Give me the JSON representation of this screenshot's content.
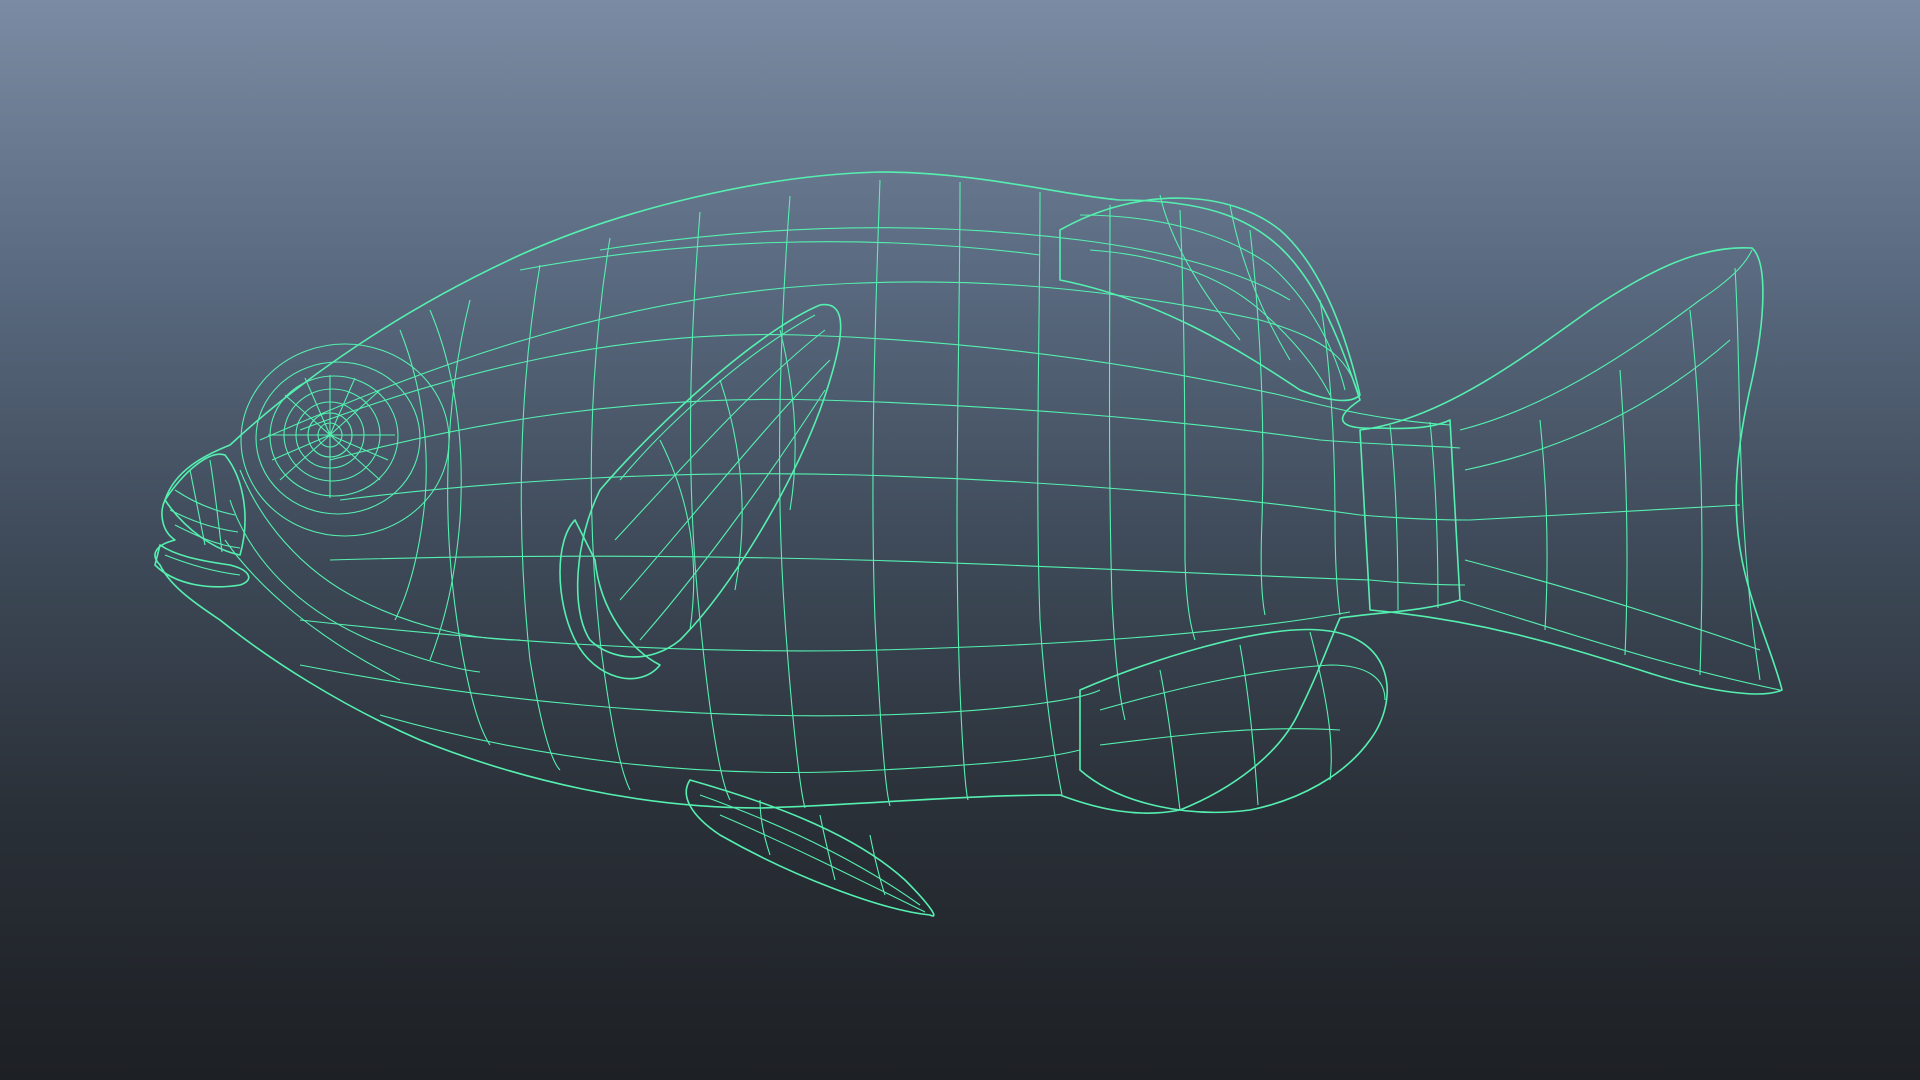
{
  "viewport": {
    "background_top": "#7b8ba3",
    "background_bottom": "#1d2024"
  },
  "model": {
    "subject": "fish-mesh",
    "display_mode": "wireframe-on-shaded",
    "shading_color": "#7a7a7a",
    "wireframe_color": "#55f0b0"
  }
}
